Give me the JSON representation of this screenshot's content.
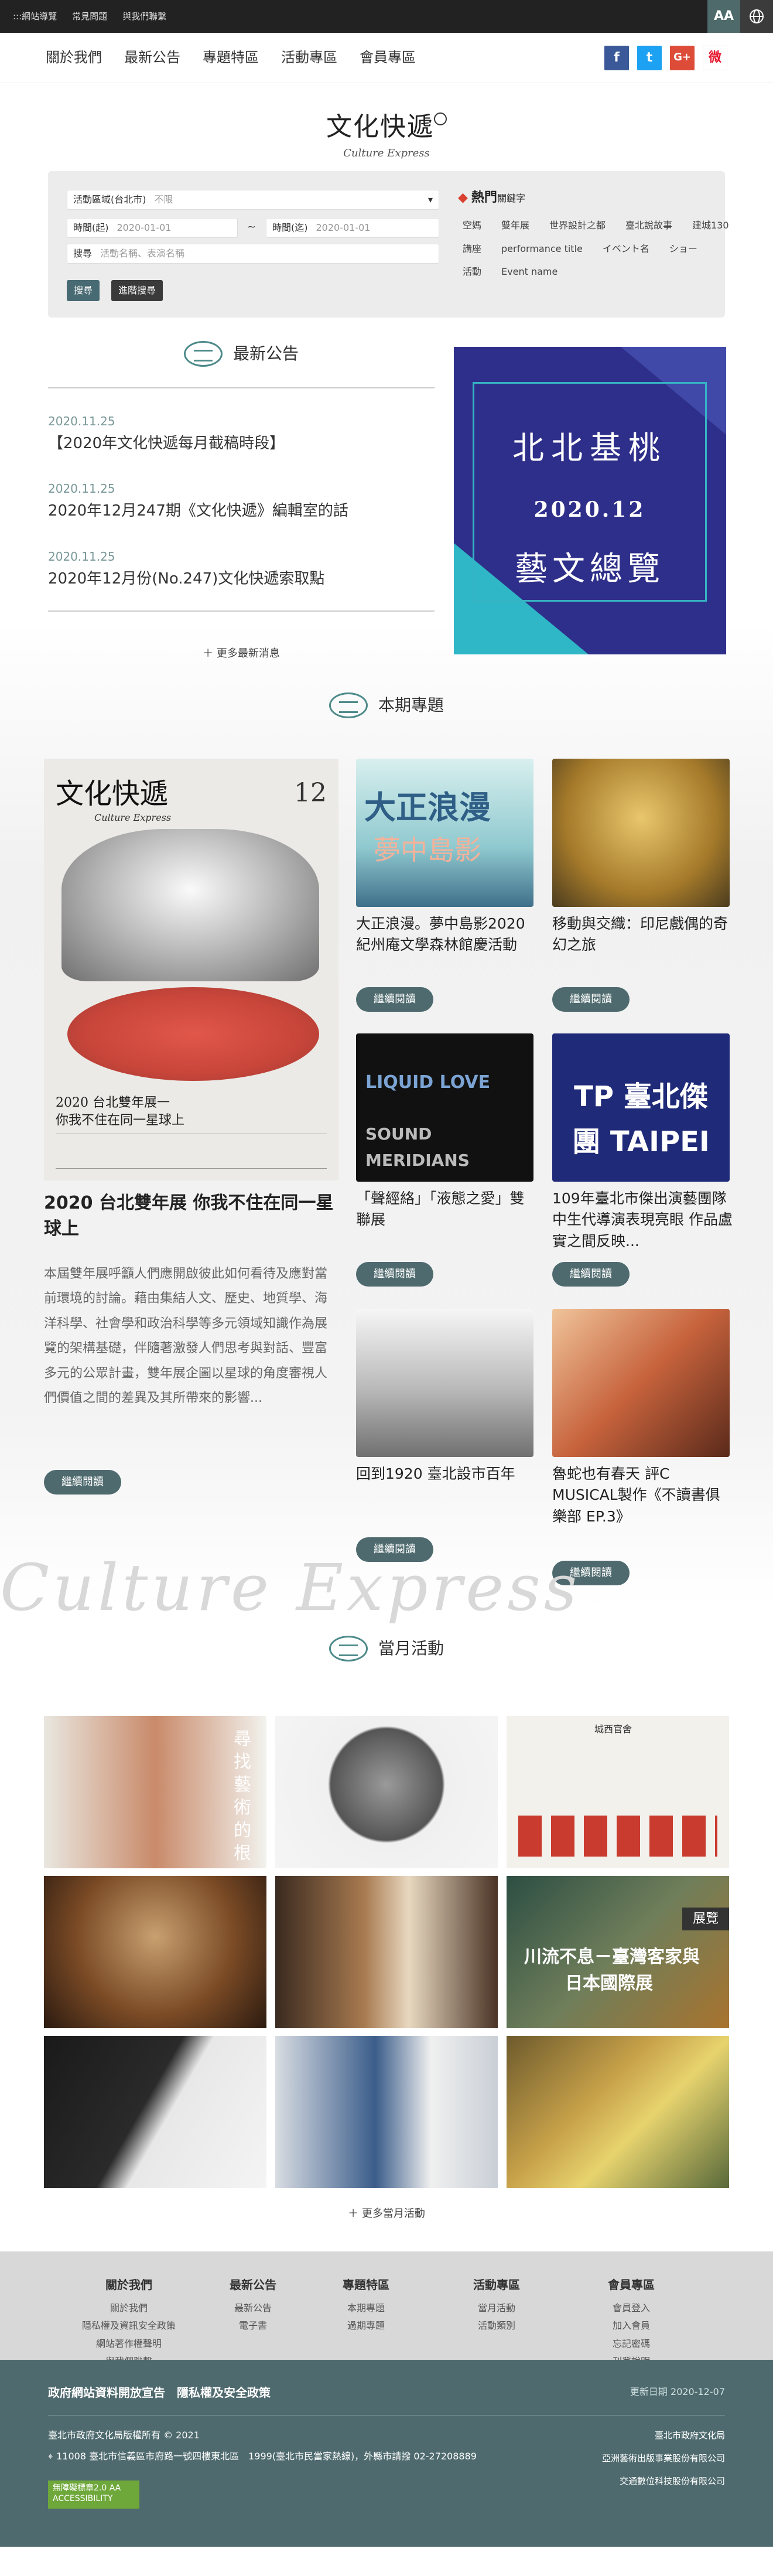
{
  "topbar": {
    "links": [
      ":::網站導覽",
      "常見問題",
      "與我們聯繫"
    ],
    "aa_label": "AA"
  },
  "nav": {
    "items": [
      "關於我們",
      "最新公告",
      "專題特區",
      "活動專區",
      "會員專區"
    ]
  },
  "social": {
    "facebook": "f",
    "twitter": "t",
    "googleplus": "G+",
    "weibo": "微"
  },
  "logo": {
    "cn": "文化快遞",
    "en": "Culture Express"
  },
  "search": {
    "area_label": "活動區域(台北市)",
    "area_value": "不限",
    "start_label": "時間(起)",
    "start_value": "2020-01-01",
    "tilde": "~",
    "end_label": "時間(迄)",
    "end_value": "2020-01-01",
    "keyword_label": "搜尋",
    "keyword_placeholder": "活動名稱、表演名稱",
    "search_btn": "搜尋",
    "advanced_btn": "進階搜尋",
    "hot_title": "熱門",
    "hot_sub": "關鍵字",
    "tags": [
      "空媽",
      "雙年展",
      "世界設計之都",
      "臺北說故事",
      "建城130",
      "講座",
      "performance title",
      "イベント名",
      "ショー",
      "活動",
      "Event name"
    ]
  },
  "news": {
    "heading": "最新公告",
    "items": [
      {
        "date": "2020.11.25",
        "title": "【2020年文化快遞每月截稿時段】"
      },
      {
        "date": "2020.11.25",
        "title": "2020年12月247期《文化快遞》編輯室的話"
      },
      {
        "date": "2020.11.25",
        "title": "2020年12月份(No.247)文化快遞索取點"
      }
    ],
    "more": "更多最新消息"
  },
  "poster": {
    "line1": "北北基桃",
    "line2": "2020.12",
    "line3": "藝文總覽"
  },
  "special": {
    "heading": "本期專題",
    "cover_title": "文化快遞",
    "cover_en": "Culture Express",
    "cover_no": "12",
    "cover_sub1": "2020 台北雙年展一",
    "cover_sub2": "你我不住在同一星球上",
    "feature_title": "2020 台北雙年展 你我不住在同一星球上",
    "feature_desc": "本屆雙年展呼籲人們應開啟彼此如何看待及應對當前環境的討論。藉由集結人文、歷史、地質學、海洋科學、社會學和政治科學等多元領域知識作為展覽的架構基礎，伴隨著激發人們思考與對話、豐富多元的公眾計畫，雙年展企圖以星球的角度審視人們價值之間的差異及其所帶來的影響...",
    "read_more": "繼續閱讀",
    "cards": [
      {
        "title": "大正浪漫。夢中島影2020紀州庵文學森林館慶活動"
      },
      {
        "title": "移動與交織：印尼戲偶的奇幻之旅"
      },
      {
        "title": "「聲經絡」「液態之愛」雙聯展"
      },
      {
        "title": "109年臺北市傑出演藝團隊 中生代導演表現亮眼 作品盧實之間反映..."
      },
      {
        "title": "回到1920 臺北設市百年"
      },
      {
        "title": "魯蛇也有春天 評C MUSICAL製作《不讀書俱樂部 EP.3》"
      }
    ],
    "card1_text1": "大正浪漫",
    "card1_text2": "夢中島影",
    "card3_text1": "LIQUID LOVE",
    "card3_text2": "SOUND MERIDIANS",
    "card4_text": "TP 臺北傑團 TAIPEI",
    "watermark": "Culture Express"
  },
  "activities": {
    "heading": "當月活動",
    "tile1_text": "尋找藝術的根",
    "tile3_text": "城西官舍",
    "tile6_badge": "展覽",
    "tile6_text1": "川流不息－臺灣客家與",
    "tile6_text2": "日本國際展",
    "more": "更多當月活動"
  },
  "footer": {
    "cols": [
      {
        "head": "關於我們",
        "items": [
          "關於我們",
          "隱私權及資訊安全政策",
          "網站著作權聲明",
          "與我們聯繫"
        ]
      },
      {
        "head": "最新公告",
        "items": [
          "最新公告",
          "電子書"
        ]
      },
      {
        "head": "專題特區",
        "items": [
          "本期專題",
          "過期專題"
        ]
      },
      {
        "head": "活動專區",
        "items": [
          "當月活動",
          "活動類別"
        ]
      },
      {
        "head": "會員專區",
        "items": [
          "會員登入",
          "加入會員",
          "忘記密碼",
          "刊登說明"
        ]
      }
    ],
    "policy": "政府網站資料開放宣告　隱私權及安全政策",
    "update": "更新日期 2020-12-07",
    "copyright": "臺北市政府文化局版權所有 © 2021",
    "address": "11008 臺北市信義區市府路一號四樓東北區　1999(臺北市民當家熱線)，外縣市請撥 02-27208889",
    "badge": "無障礙標章2.0 AA ACCESSIBILITY",
    "logo1": "臺北市政府文化局",
    "logo2": "亞洲藝術出版事業股份有限公司",
    "logo3": "交通數位科技股份有限公司"
  }
}
